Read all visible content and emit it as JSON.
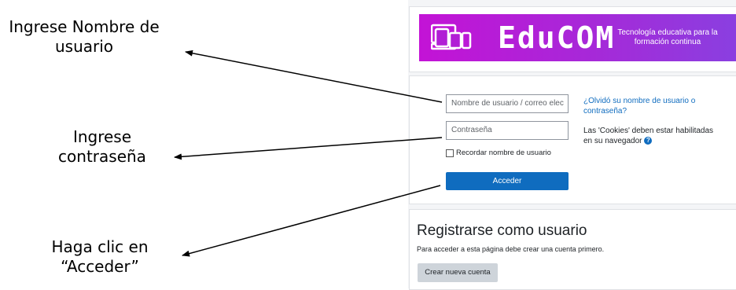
{
  "annotations": {
    "username": "Ingrese Nombre de usuario",
    "password": "Ingrese contraseña",
    "login": "Haga clic en “Acceder”"
  },
  "branding": {
    "name": "EduCOM",
    "tagline": "Tecnología educativa  para la formación continua"
  },
  "login": {
    "username_placeholder": "Nombre de usuario / correo elec",
    "password_placeholder": "Contraseña",
    "remember_label": "Recordar nombre de usuario",
    "submit_label": "Acceder",
    "forgot_link": "¿Olvidó su nombre de usuario o contraseña?",
    "cookies_notice": "Las 'Cookies' deben estar habilitadas en su navegador"
  },
  "register": {
    "title": "Registrarse como usuario",
    "description": "Para acceder a esta página debe crear una cuenta primero.",
    "button_label": "Crear nueva cuenta"
  },
  "colors": {
    "primary": "#0f6cbf",
    "banner_start": "#c313d6",
    "banner_end": "#8a3fe0"
  }
}
